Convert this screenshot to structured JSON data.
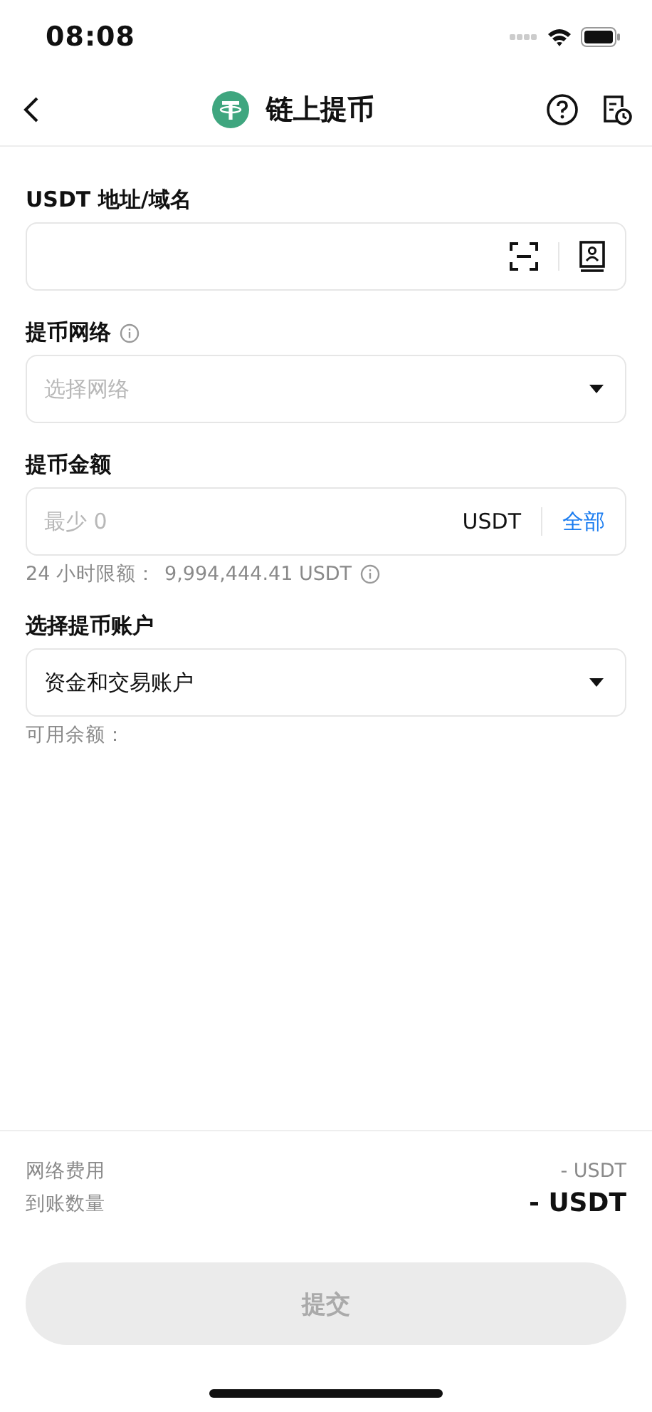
{
  "status_bar": {
    "time": "08:08"
  },
  "header": {
    "title": "链上提币"
  },
  "address": {
    "label": "USDT 地址/域名"
  },
  "network": {
    "label": "提币网络",
    "placeholder": "选择网络"
  },
  "amount": {
    "label": "提币金额",
    "placeholder": "最少 0",
    "unit": "USDT",
    "all_link": "全部",
    "limit_label": "24 小时限额：",
    "limit_value": "9,994,444.41 USDT"
  },
  "account": {
    "label": "选择提币账户",
    "value": "资金和交易账户",
    "available_label": "可用余额："
  },
  "summary": [
    {
      "label": "网络费用",
      "value": "- USDT",
      "emphasis": false
    },
    {
      "label": "到账数量",
      "value": "- USDT",
      "emphasis": true
    }
  ],
  "submit": {
    "label": "提交",
    "disabled": true
  }
}
